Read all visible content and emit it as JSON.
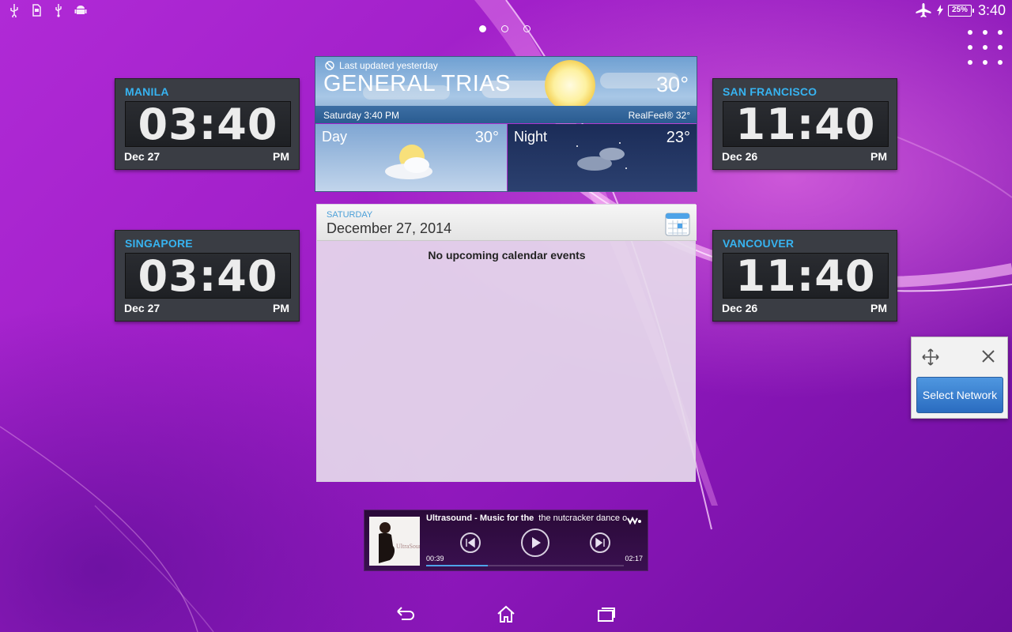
{
  "statusbar": {
    "left_icons": [
      "usb-icon",
      "sd-card-icon",
      "usb-debug-icon",
      "android-icon"
    ],
    "battery_percent": "25%",
    "time": "3:40"
  },
  "home": {
    "pages": 3,
    "active_page": 1
  },
  "clocks": [
    {
      "city": "MANILA",
      "time": "03:40",
      "date": "Dec 27",
      "ampm": "PM"
    },
    {
      "city": "SINGAPORE",
      "time": "03:40",
      "date": "Dec 27",
      "ampm": "PM"
    },
    {
      "city": "SAN FRANCISCO",
      "time": "11:40",
      "date": "Dec 26",
      "ampm": "PM"
    },
    {
      "city": "VANCOUVER",
      "time": "11:40",
      "date": "Dec 26",
      "ampm": "PM"
    }
  ],
  "weather": {
    "updated": "Last updated yesterday",
    "city": "GENERAL TRIAS",
    "temp": "30°",
    "subtitle": "Saturday 3:40 PM",
    "realfeel": "RealFeel® 32°",
    "day_label": "Day",
    "day_temp": "30°",
    "night_label": "Night",
    "night_temp": "23°"
  },
  "calendar": {
    "weekday": "SATURDAY",
    "date": "December 27, 2014",
    "empty_text": "No upcoming calendar events"
  },
  "network": {
    "button_label": "Select Network"
  },
  "music": {
    "title": "Ultrasound - Music for the",
    "subtitle": "the nutcracker dance of th",
    "elapsed": "00:39",
    "total": "02:17",
    "progress_fraction": 0.31,
    "cover_text": "UltraSound"
  },
  "colors": {
    "accent": "#37b3f0",
    "wallpaper": "#a01fc8"
  }
}
